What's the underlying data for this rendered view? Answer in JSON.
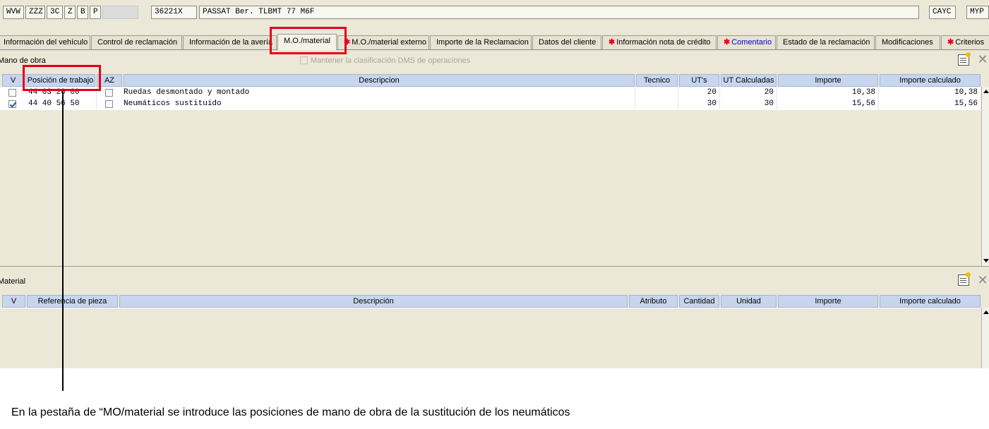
{
  "header": {
    "fields": [
      "WVW",
      "ZZZ",
      "3C",
      "Z",
      "B",
      "P",
      "",
      "36221X",
      "PASSAT Ber. TLBMT 77 M6F",
      "",
      "CAYC",
      "MYP"
    ]
  },
  "tabs": [
    {
      "label": "Información del vehículo",
      "required": false
    },
    {
      "label": "Control de reclamación",
      "required": false
    },
    {
      "label": "Información de la avería",
      "required": false
    },
    {
      "label": "M.O./material",
      "required": false,
      "active": true
    },
    {
      "label": "M.O./material externo",
      "required": true
    },
    {
      "label": "Importe de la Reclamacion",
      "required": false
    },
    {
      "label": "Datos del cliente",
      "required": false
    },
    {
      "label": "Información nota de crédito",
      "required": true
    },
    {
      "label": "Comentario",
      "required": true
    },
    {
      "label": "Estado de la reclamación",
      "required": false
    },
    {
      "label": "Modificaciones",
      "required": false
    },
    {
      "label": "Criterios",
      "required": true
    }
  ],
  "labor": {
    "title": "Mano de obra",
    "keep_dms_label": "Mantener la clasificación DMS de operaciones",
    "columns": [
      "V",
      "Posición de trabajo",
      "AZ",
      "Descripcion",
      "Tecnico",
      "UT's",
      "UT Calculadas",
      "Importe",
      "Importe calculado"
    ],
    "rows": [
      {
        "checked": false,
        "position": "44 03 20 00",
        "az": false,
        "description": "Ruedas desmontado y montado",
        "tecnico": "",
        "ut": "20",
        "ut_calc": "20",
        "importe": "10,38",
        "importe_calc": "10,38"
      },
      {
        "checked": true,
        "position": "44 40 56 50",
        "az": false,
        "description": "Neumáticos sustituido",
        "tecnico": "",
        "ut": "30",
        "ut_calc": "30",
        "importe": "15,56",
        "importe_calc": "15,56"
      }
    ]
  },
  "material": {
    "title": "Material",
    "columns": [
      "V",
      "Referencia de pieza",
      "Descripción",
      "Atributo",
      "Cantidad",
      "Unidad",
      "Importe",
      "Importe calculado"
    ]
  },
  "caption": "En la pestaña de “MO/material se introduce las posiciones de mano de obra de la sustitución de los neumáticos",
  "colors": {
    "highlight": "#e2001a",
    "required_star": "#e8001c",
    "header_blue": "#c7d6ee",
    "panel_bg": "#ebe8d8"
  },
  "icons": [
    "new-document-icon",
    "close-icon",
    "scroll-up-icon",
    "scroll-down-icon",
    "required-star-icon"
  ]
}
